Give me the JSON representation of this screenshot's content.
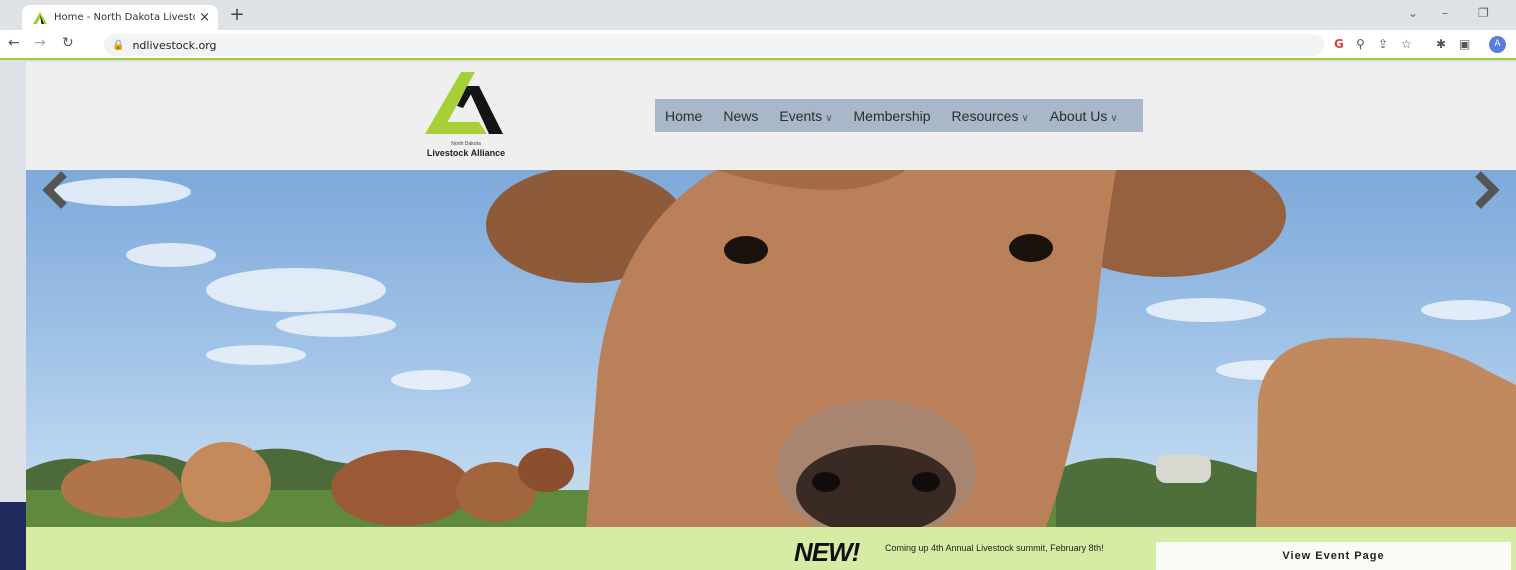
{
  "browser": {
    "tab_title": "Home - North Dakota Livestock A",
    "tab_close": "×",
    "new_tab": "+",
    "url": "ndlivestock.org",
    "profile_initial": "A",
    "accent_color": "#9ccc3c"
  },
  "site": {
    "logo": {
      "small_text": "North Dakota",
      "name": "Livestock Alliance",
      "brand_green": "#a6cf38",
      "brand_black": "#141414"
    },
    "nav": {
      "items": [
        {
          "label": "Home",
          "dropdown": false
        },
        {
          "label": "News",
          "dropdown": false
        },
        {
          "label": "Events",
          "dropdown": true
        },
        {
          "label": "Membership",
          "dropdown": false
        },
        {
          "label": "Resources",
          "dropdown": true
        },
        {
          "label": "About Us",
          "dropdown": true
        }
      ],
      "bg_color": "#a8b8c8"
    },
    "hero": {
      "image": "cow-closeup-photo",
      "prev_icon": "chevron-left-icon",
      "next_icon": "chevron-right-icon"
    },
    "banner": {
      "new_label": "NEW!",
      "text": "Coming up 4th Annual Livestock summit, February 8th!",
      "button_label": "View Event Page",
      "bg_color": "#d6eca4"
    }
  }
}
